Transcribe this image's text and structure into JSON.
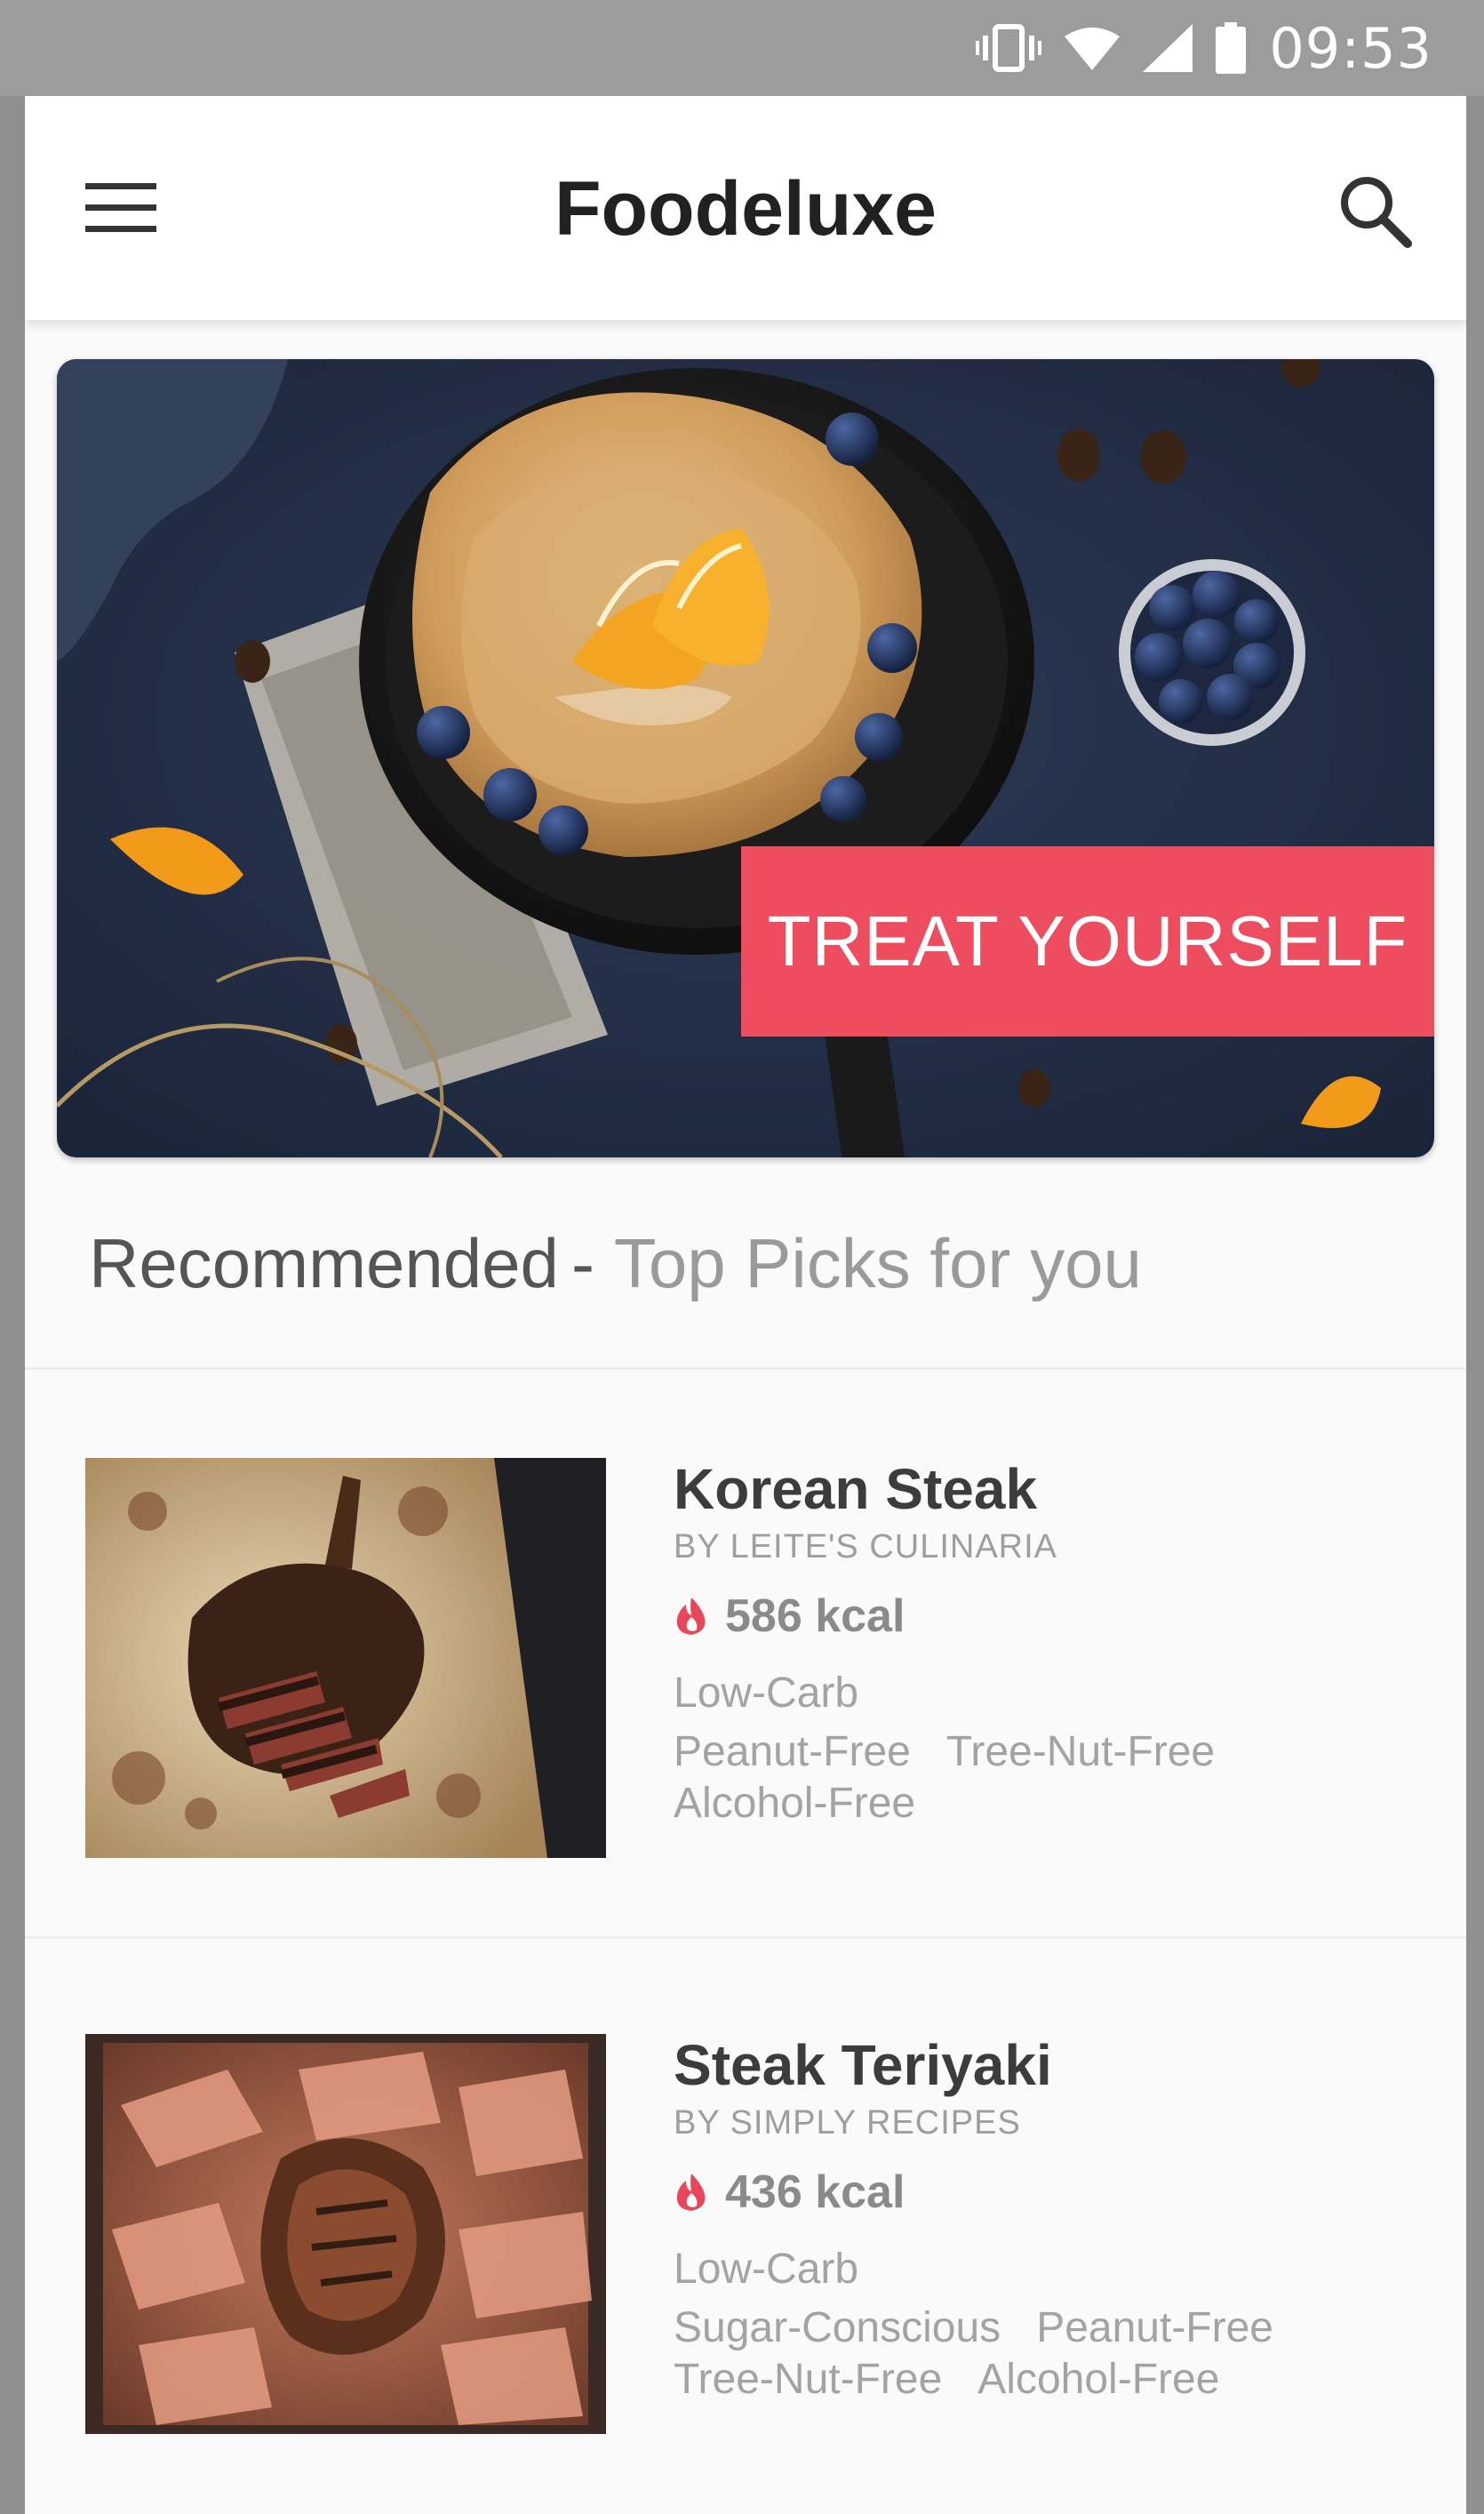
{
  "status_bar": {
    "time": "09:53",
    "icons": [
      "vibrate-icon",
      "wifi-icon",
      "signal-icon",
      "battery-icon"
    ]
  },
  "app_bar": {
    "title": "Foodeluxe",
    "menu_icon": "hamburger-menu-icon",
    "search_icon": "search-icon"
  },
  "hero": {
    "badge_label": "TREAT YOURSELF",
    "badge_color": "#ee4d5f"
  },
  "section": {
    "title": "Recommended",
    "separator": "-",
    "subtitle": "Top Picks for you"
  },
  "recipes": [
    {
      "name": "Korean Steak",
      "source": "BY LEITE'S CULINARIA",
      "kcal": "586 kcal",
      "tag_rows": [
        [
          "Low-Carb"
        ],
        [
          "Peanut-Free",
          "Tree-Nut-Free"
        ],
        [
          "Alcohol-Free"
        ]
      ]
    },
    {
      "name": "Steak Teriyaki",
      "source": "BY SIMPLY RECIPES",
      "kcal": "436 kcal",
      "tag_rows": [
        [
          "Low-Carb"
        ],
        [
          "Sugar-Conscious",
          "Peanut-Free"
        ],
        [
          "Tree-Nut-Free",
          "Alcohol-Free"
        ]
      ]
    }
  ],
  "colors": {
    "accent": "#ee4d5f",
    "flame": "#e8475b"
  }
}
